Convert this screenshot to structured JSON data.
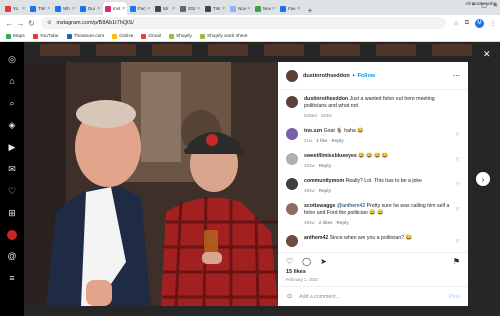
{
  "tabs": [
    {
      "label": "Yo",
      "color": "#e53935"
    },
    {
      "label": "TW",
      "color": "#1a73e8"
    },
    {
      "label": "Wh",
      "color": "#1a73e8"
    },
    {
      "label": "Dui",
      "color": "#1a73e8"
    },
    {
      "label": "Inst",
      "color": "#d62976",
      "active": true
    },
    {
      "label": "Fac",
      "color": "#1877f2"
    },
    {
      "label": "Mi",
      "color": "#444444"
    },
    {
      "label": "202",
      "color": "#666666"
    },
    {
      "label": "TW",
      "color": "#444444"
    },
    {
      "label": "Nov",
      "color": "#8ab4f8"
    },
    {
      "label": "Nev",
      "color": "#43a047"
    },
    {
      "label": "Fav",
      "color": "#1a73e8"
    }
  ],
  "browser": {
    "url": "instagram.com/p/B8Ab1t7hQtS/",
    "profile_initial": "M"
  },
  "bookmarks": [
    {
      "label": "Maps",
      "color": "#34a853"
    },
    {
      "label": "YouTube",
      "color": "#e53935"
    },
    {
      "label": "Theasure.com",
      "color": "#1565c0"
    },
    {
      "label": "Gdrive",
      "color": "#fbbc04"
    },
    {
      "label": "Gmail",
      "color": "#ea4335"
    },
    {
      "label": "Shopify",
      "color": "#95bf47"
    },
    {
      "label": "Shopify work sheet",
      "color": "#95bf47"
    }
  ],
  "bookmarks_all": "All Bookmarks",
  "post": {
    "author": "dustinrothseddon",
    "follow_label": "Follow",
    "caption": "Just a wanted felon out here meeting politicians and what not",
    "caption_meta": "Edited · 284w",
    "likes": "15 likes",
    "date": "February 1, 2020",
    "add_comment_placeholder": "Add a comment...",
    "post_label": "Post"
  },
  "comments": [
    {
      "user": "tno.szn",
      "text": "Goat 🐐 haha 😂",
      "time": "21w",
      "likes": "1 like",
      "reply": "Reply",
      "color": "#7b5ea7"
    },
    {
      "user": "sweetlilmissblueeyes",
      "text": "😂 😂 😂 😂",
      "time": "284w",
      "likes": "",
      "reply": "Reply",
      "color": "#b0b0b0"
    },
    {
      "user": "communitymom",
      "text": "Really? Lol. This has to be a joke",
      "time": "284w",
      "likes": "",
      "reply": "Reply",
      "color": "#3f3f3f"
    },
    {
      "user": "scottswaggs",
      "mention": "@anthem42",
      "text": "Pretty sure he was calling him self a felon and Ford the politician 😂 😂",
      "time": "284w",
      "likes": "2 likes",
      "reply": "Reply",
      "color": "#8d6e63"
    },
    {
      "user": "anthem42",
      "text": "Since when are you a politician? 😂",
      "time": "",
      "likes": "",
      "reply": "",
      "color": "#6d4c41"
    }
  ]
}
